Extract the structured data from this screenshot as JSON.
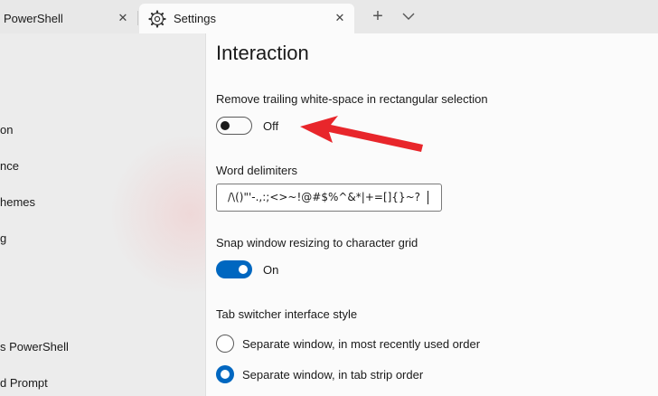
{
  "tabs": [
    {
      "label": "PowerShell",
      "close": "✕"
    },
    {
      "label": "Settings",
      "close": "✕",
      "icon": "gear-icon"
    }
  ],
  "tab_actions": {
    "new_tab": "+",
    "dropdown_icon": "chevron-down-icon"
  },
  "sidebar": {
    "items": [
      {
        "label": "on"
      },
      {
        "label": "nce"
      },
      {
        "label": "hemes"
      },
      {
        "label": "g"
      },
      {
        "label": "s PowerShell"
      },
      {
        "label": "d Prompt"
      }
    ]
  },
  "main": {
    "title": "Interaction",
    "trim_whitespace": {
      "label": "Remove trailing white-space in rectangular selection",
      "state": "Off"
    },
    "word_delimiters": {
      "label": "Word delimiters",
      "value": "/\\()\"'-.,:;<>~!@#$%^&*|+=[]{}~? "
    },
    "snap_resize": {
      "label": "Snap window resizing to character grid",
      "state": "On"
    },
    "tab_switcher": {
      "label": "Tab switcher interface style",
      "options": [
        {
          "label": "Separate window, in most recently used order",
          "selected": false
        },
        {
          "label": "Separate window, in tab strip order",
          "selected": true
        }
      ]
    }
  },
  "colors": {
    "accent": "#0067c0",
    "annotation_arrow": "#e8262b"
  }
}
